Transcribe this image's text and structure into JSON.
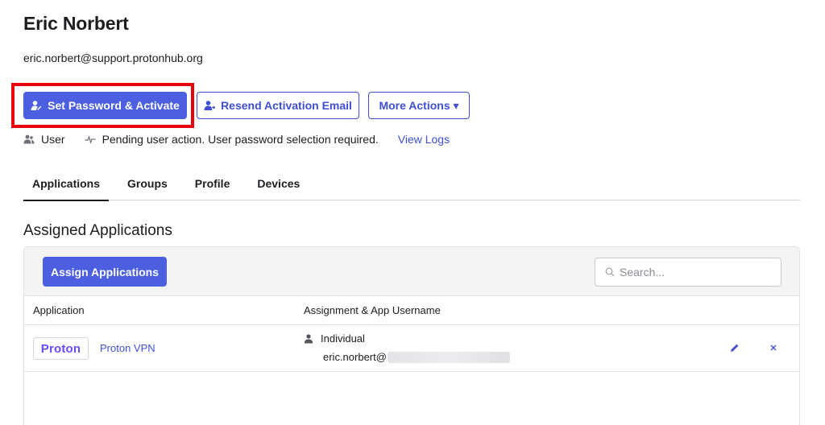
{
  "user": {
    "name": "Eric Norbert",
    "email": "eric.norbert@support.protonhub.org"
  },
  "actions": {
    "set_password_label": "Set Password & Activate",
    "resend_label": "Resend Activation Email",
    "more_actions_label": "More Actions ▾"
  },
  "status": {
    "role": "User",
    "message": "Pending user action. User password selection required.",
    "view_logs": "View Logs"
  },
  "tabs": [
    {
      "label": "Applications",
      "active": true
    },
    {
      "label": "Groups"
    },
    {
      "label": "Profile"
    },
    {
      "label": "Devices"
    }
  ],
  "section": {
    "title": "Assigned Applications",
    "assign_button": "Assign Applications",
    "search_placeholder": "Search..."
  },
  "table": {
    "columns": [
      "Application",
      "Assignment & App Username"
    ],
    "rows": [
      {
        "logo_text": "Proton",
        "app_name": "Proton VPN",
        "assignment_type": "Individual",
        "username": "eric.norbert@"
      }
    ]
  },
  "colors": {
    "primary": "#4b5fe0",
    "link": "#3e4fd6",
    "highlight": "#e8000b"
  }
}
